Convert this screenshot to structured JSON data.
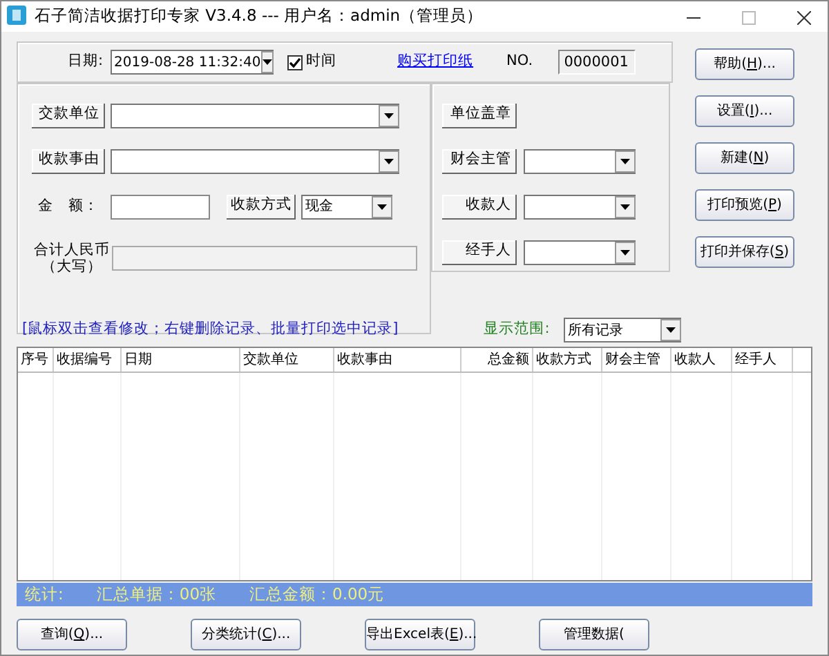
{
  "window": {
    "title": "石子简洁收据打印专家 V3.4.8 --- 用户名：admin（管理员）"
  },
  "header": {
    "date_label": "日期:",
    "date_value": "2019-08-28 11:32:40",
    "time_checkbox": {
      "label": "时间",
      "checked": true
    },
    "buy_link": "购买打印纸",
    "no_label": "NO.",
    "no_value": "0000001"
  },
  "left_rows": [
    {
      "kind": "combo",
      "button": "交款单位"
    },
    {
      "kind": "combo",
      "button": "收款事由"
    },
    {
      "kind": "amount",
      "label": "金　额：",
      "method_button": "收款方式",
      "method_value": "现金"
    },
    {
      "kind": "total",
      "label_lines": [
        "合计人民币",
        "（大写）"
      ]
    }
  ],
  "right_rows": [
    {
      "kind": "button",
      "button": "单位盖章"
    },
    {
      "kind": "combo",
      "button": "财会主管"
    },
    {
      "kind": "combo",
      "button": "收款人"
    },
    {
      "kind": "combo",
      "button": "经手人"
    }
  ],
  "side_buttons": [
    "帮助(**H**)...",
    "设置(**I**)...",
    "新建(**N**)",
    "打印预览(**P**)",
    "打印并保存(**S**)"
  ],
  "hint": "[鼠标双击查看修改；右键删除记录、批量打印选中记录]",
  "range": {
    "label": "显示范围:",
    "value": "所有记录"
  },
  "table": {
    "columns": [
      "序号",
      "收据编号",
      "日期",
      "交款单位",
      "收款事由",
      "总金额",
      "收款方式",
      "财会主管",
      "收款人",
      "经手人"
    ]
  },
  "status_bar": [
    "统计:",
    "汇总单据：00张",
    "汇总金额：0.00元"
  ],
  "bottom_buttons": [
    {
      "label": "查询(**Q**)..."
    },
    {
      "label": "分类统计(**C**)..."
    },
    {
      "label": "导出Excel表(**E**)..."
    },
    {
      "label": "管理数据("
    }
  ]
}
